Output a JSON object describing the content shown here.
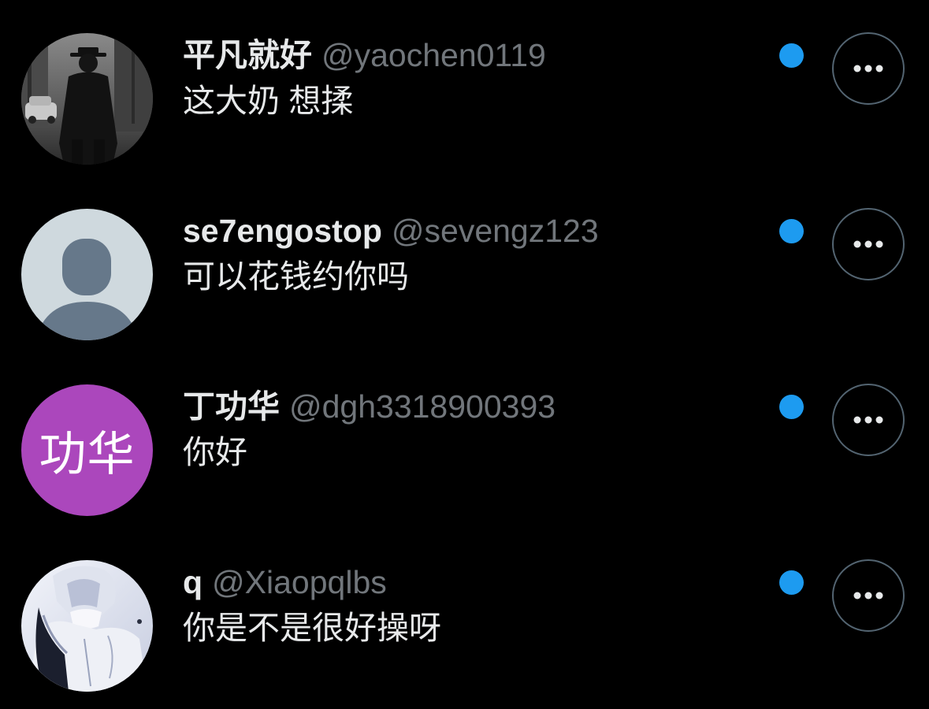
{
  "colors": {
    "background": "#000000",
    "text": "#e7e9ea",
    "handle": "#71767b",
    "unread_dot": "#1d9bf0",
    "button_border": "#536471"
  },
  "messages": [
    {
      "display_name": "平凡就好",
      "handle": "@yaochen0119",
      "text": "这大奶 想揉",
      "avatar": {
        "type": "photo",
        "icon": "noir-figure-avatar-icon"
      },
      "unread": true,
      "more_icon": "more-horizontal-icon"
    },
    {
      "display_name": "se7engostop",
      "handle": "@sevengz123",
      "text": "可以花钱约你吗",
      "avatar": {
        "type": "default",
        "icon": "default-profile-avatar-icon"
      },
      "unread": true,
      "more_icon": "more-horizontal-icon"
    },
    {
      "display_name": "丁功华",
      "handle": "@dgh3318900393",
      "text": "你好",
      "avatar": {
        "type": "text",
        "label": "功华",
        "color": "#ab47bc"
      },
      "unread": true,
      "more_icon": "more-horizontal-icon"
    },
    {
      "display_name": "q",
      "handle": "@Xiaopqlbs",
      "text": "你是不是很好操呀",
      "avatar": {
        "type": "photo",
        "icon": "anime-character-avatar-icon"
      },
      "unread": true,
      "more_icon": "more-horizontal-icon"
    }
  ]
}
